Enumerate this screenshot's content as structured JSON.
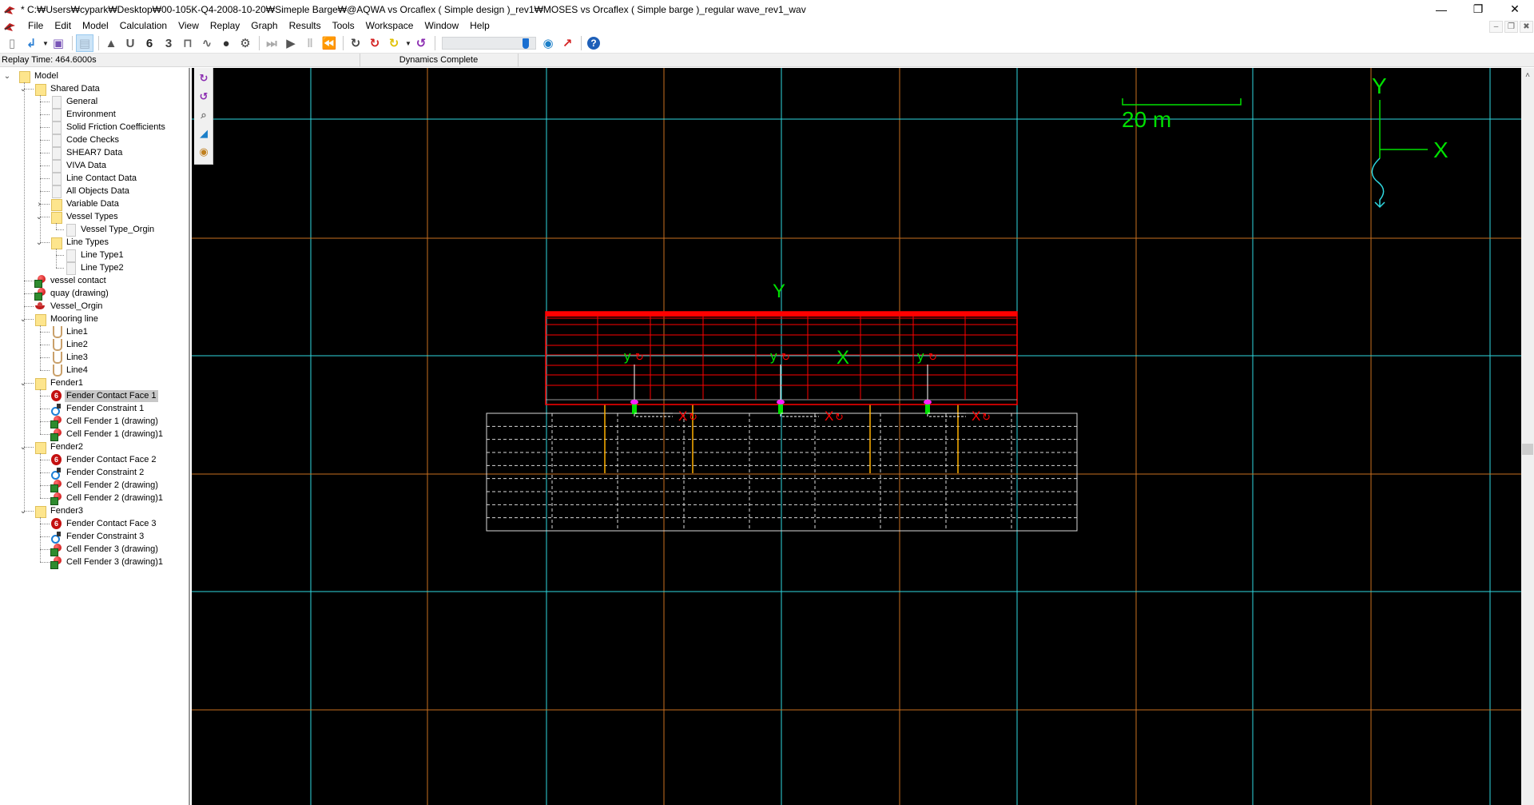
{
  "window": {
    "title": "* C:₩Users₩cypark₩Desktop₩00-105K-Q4-2008-10-20₩Simeple Barge₩@AQWA vs Orcaflex ( Simple design )_rev1₩MOSES vs Orcaflex ( Simple barge )_regular wave_rev1_wav",
    "controls": {
      "minimize": "—",
      "restore": "❐",
      "close": "✕"
    },
    "mdi_controls": {
      "minimize": "–",
      "restore": "❐",
      "close": "✖"
    }
  },
  "menu": {
    "items": [
      "File",
      "Edit",
      "Model",
      "Calculation",
      "View",
      "Replay",
      "Graph",
      "Results",
      "Tools",
      "Workspace",
      "Window",
      "Help"
    ]
  },
  "toolbar": {
    "buttons": [
      {
        "name": "new-file-icon",
        "glyph": "▯",
        "color": "#888888"
      },
      {
        "name": "open-file-icon",
        "glyph": "↲",
        "color": "#2a7fd4"
      },
      {
        "name": "save-icon",
        "glyph": "▣",
        "color": "#7a56b8"
      },
      {
        "name": "model-browser-icon",
        "glyph": "▤",
        "color": "#a0b4c8",
        "active": true
      },
      {
        "name": "new-vessel-icon",
        "glyph": "▲",
        "color": "#555555"
      },
      {
        "name": "new-line-icon",
        "glyph": "U",
        "color": "#555555"
      },
      {
        "name": "new-6d-buoy-icon",
        "glyph": "6",
        "color": "#222222"
      },
      {
        "name": "new-3d-buoy-icon",
        "glyph": "3",
        "color": "#444444"
      },
      {
        "name": "new-winch-icon",
        "glyph": "⊓",
        "color": "#666666"
      },
      {
        "name": "new-link-icon",
        "glyph": "∿",
        "color": "#666666"
      },
      {
        "name": "new-shape-icon",
        "glyph": "●",
        "color": "#333333"
      },
      {
        "name": "new-constraint-icon",
        "glyph": "⚙",
        "color": "#444444"
      },
      {
        "name": "step-icon",
        "glyph": "⏭",
        "color": "#aaaaaa"
      },
      {
        "name": "play-icon",
        "glyph": "▶",
        "color": "#555555"
      },
      {
        "name": "pause-icon",
        "glyph": "‖",
        "color": "#bbbbbb"
      },
      {
        "name": "rewind-icon",
        "glyph": "⏪",
        "color": "#d42020"
      },
      {
        "name": "run-statics-icon",
        "glyph": "↻",
        "color": "#444444"
      },
      {
        "name": "run-dynamics-icon",
        "glyph": "↻",
        "color": "#d42020"
      },
      {
        "name": "pause-simulation-icon",
        "glyph": "↻",
        "color": "#e0c000"
      },
      {
        "name": "reset-icon",
        "glyph": "↺",
        "color": "#8a2ab0"
      },
      {
        "name": "view-icon",
        "glyph": "◉",
        "color": "#1c7fc8"
      },
      {
        "name": "graph-icon",
        "glyph": "↗",
        "color": "#d42020"
      },
      {
        "name": "help-icon",
        "glyph": "?",
        "color": "#ffffff",
        "bg": "#1e5fb8"
      }
    ],
    "replay_slider": {
      "value_fraction": 0.93
    }
  },
  "status": {
    "replay_time": "Replay Time: 464.6000s",
    "state": "Dynamics Complete"
  },
  "tree": {
    "items": [
      {
        "label": "Model",
        "icon": "folder",
        "level": 0,
        "expanded": true
      },
      {
        "label": "Shared Data",
        "icon": "folder",
        "level": 1,
        "expanded": true
      },
      {
        "label": "General",
        "icon": "doc",
        "level": 2
      },
      {
        "label": "Environment",
        "icon": "doc",
        "level": 2
      },
      {
        "label": "Solid Friction Coefficients",
        "icon": "doc",
        "level": 2
      },
      {
        "label": "Code Checks",
        "icon": "doc",
        "level": 2
      },
      {
        "label": "SHEAR7 Data",
        "icon": "doc",
        "level": 2
      },
      {
        "label": "VIVA Data",
        "icon": "doc",
        "level": 2
      },
      {
        "label": "Line Contact Data",
        "icon": "doc",
        "level": 2
      },
      {
        "label": "All Objects Data",
        "icon": "doc",
        "level": 2
      },
      {
        "label": "Variable Data",
        "icon": "folder",
        "level": 2,
        "collapsed": true
      },
      {
        "label": "Vessel Types",
        "icon": "folder",
        "level": 2,
        "expanded": true
      },
      {
        "label": "Vessel Type_Orgin",
        "icon": "doc",
        "level": 3
      },
      {
        "label": "Line Types",
        "icon": "folder",
        "level": 2,
        "expanded": true
      },
      {
        "label": "Line Type1",
        "icon": "doc",
        "level": 3
      },
      {
        "label": "Line Type2",
        "icon": "doc",
        "level": 3
      },
      {
        "label": "vessel contact",
        "icon": "ball",
        "level": 1
      },
      {
        "label": "quay (drawing)",
        "icon": "ball",
        "level": 1
      },
      {
        "label": "Vessel_Orgin",
        "icon": "vessel",
        "level": 1
      },
      {
        "label": "Mooring line",
        "icon": "folder",
        "level": 1,
        "expanded": true
      },
      {
        "label": "Line1",
        "icon": "line",
        "level": 2
      },
      {
        "label": "Line2",
        "icon": "line",
        "level": 2
      },
      {
        "label": "Line3",
        "icon": "line",
        "level": 2
      },
      {
        "label": "Line4",
        "icon": "line",
        "level": 2
      },
      {
        "label": "Fender1",
        "icon": "folder",
        "level": 1,
        "expanded": true
      },
      {
        "label": "Fender Contact Face 1",
        "icon": "fender",
        "level": 2,
        "selected": true
      },
      {
        "label": "Fender Constraint  1",
        "icon": "constraint",
        "level": 2
      },
      {
        "label": "Cell Fender 1 (drawing)",
        "icon": "ball",
        "level": 2
      },
      {
        "label": "Cell Fender 1 (drawing)1",
        "icon": "ball",
        "level": 2
      },
      {
        "label": "Fender2",
        "icon": "folder",
        "level": 1,
        "expanded": true
      },
      {
        "label": "Fender Contact Face 2",
        "icon": "fender",
        "level": 2
      },
      {
        "label": "Fender Constraint 2",
        "icon": "constraint",
        "level": 2
      },
      {
        "label": "Cell Fender 2 (drawing)",
        "icon": "ball",
        "level": 2
      },
      {
        "label": "Cell Fender 2 (drawing)1",
        "icon": "ball",
        "level": 2
      },
      {
        "label": "Fender3",
        "icon": "folder",
        "level": 1,
        "expanded": true
      },
      {
        "label": "Fender Contact Face 3",
        "icon": "fender",
        "level": 2
      },
      {
        "label": "Fender Constraint 3",
        "icon": "constraint",
        "level": 2
      },
      {
        "label": "Cell Fender 3 (drawing)",
        "icon": "ball",
        "level": 2
      },
      {
        "label": "Cell Fender 3 (drawing)1",
        "icon": "ball",
        "level": 2
      }
    ]
  },
  "view_tools": [
    {
      "name": "rotate-up-icon",
      "glyph": "↻",
      "color": "#8a2ab0"
    },
    {
      "name": "rotate-around-icon",
      "glyph": "↺",
      "color": "#8a2ab0"
    },
    {
      "name": "zoom-icon",
      "glyph": "⌕",
      "color": "#777777"
    },
    {
      "name": "shaded-view-icon",
      "glyph": "◢",
      "color": "#1c7fc8"
    },
    {
      "name": "view-parameters-icon",
      "glyph": "◉",
      "color": "#c08020"
    }
  ],
  "viewport": {
    "scale_label": "20 m",
    "axis_labels": {
      "global_y": "Y",
      "global_x": "X",
      "vessel_y": "Y",
      "vessel_x": "X",
      "local_y": "y",
      "local_x": "X",
      "rot": "↻"
    },
    "colors": {
      "background": "#000000",
      "grid_major": "#2fd8e0",
      "grid_minor": "#c87020",
      "vessel": "#ff0000",
      "quay": "#d8d8d8",
      "mooring": "#ffb000",
      "axis": "#00e000",
      "fender_marker": "#ff20ff",
      "wave": "#2fd8e0"
    },
    "fender_count": 3,
    "mooring_line_count": 4
  }
}
